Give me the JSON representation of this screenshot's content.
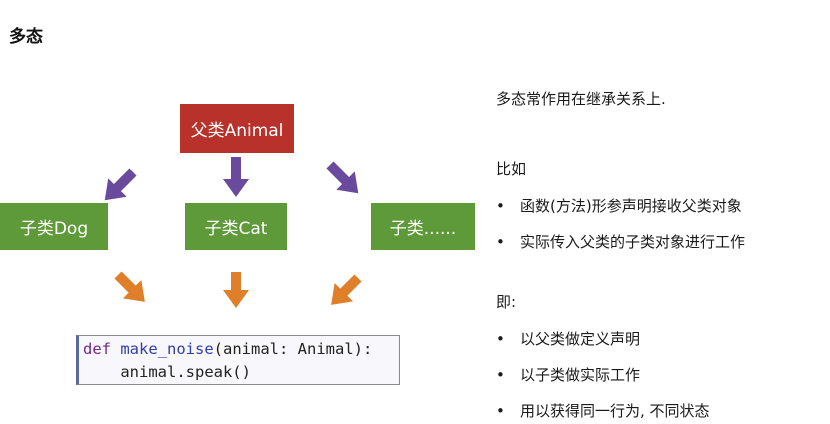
{
  "slide": {
    "title": "多态",
    "diagram": {
      "parent_label": "父类Animal",
      "children": [
        "子类Dog",
        "子类Cat",
        "子类......"
      ],
      "colors": {
        "parent": "#b8312b",
        "child": "#5f9a3a",
        "arrow_up": "#6a4a9c",
        "arrow_down": "#e07f2a"
      }
    },
    "code": {
      "line1": {
        "kw": "def",
        "fn": "make_noise",
        "rest": "(animal: Animal):"
      },
      "line2": "    animal.speak()"
    },
    "text": {
      "intro": "多态常作用在继承关系上.",
      "example_heading": "比如",
      "example_points": [
        "函数(方法)形参声明接收父类对象",
        "实际传入父类的子类对象进行工作"
      ],
      "i_e_heading": "即:",
      "i_e_points": [
        "以父类做定义声明",
        "以子类做实际工作",
        "用以获得同一行为, 不同状态"
      ]
    }
  }
}
